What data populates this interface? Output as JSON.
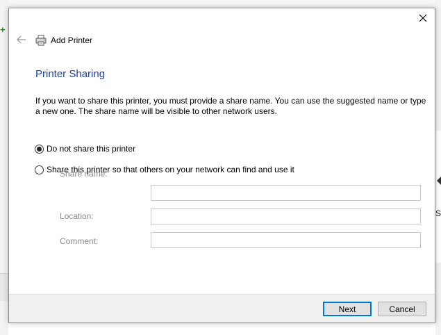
{
  "background": {
    "right_text": "S"
  },
  "dialog": {
    "header_title": "Add Printer",
    "page_title": "Printer Sharing",
    "description": "If you want to share this printer, you must provide a share name. You can use the suggested name or type a new one. The share name will be visible to other network users.",
    "options": [
      {
        "label": "Do not share this printer",
        "selected": true
      },
      {
        "label": "Share this printer so that others on your network can find and use it",
        "selected": false
      }
    ],
    "fields": {
      "share_name": {
        "label": "Share name:",
        "value": ""
      },
      "location": {
        "label": "Location:",
        "value": ""
      },
      "comment": {
        "label": "Comment:",
        "value": ""
      }
    },
    "buttons": {
      "next": "Next",
      "cancel": "Cancel"
    }
  },
  "icons": {
    "close": "close-icon",
    "back": "back-arrow-icon",
    "printer": "printer-icon"
  },
  "colors": {
    "title_blue": "#1c3ea8",
    "primary_border": "#0078d7",
    "footer_bg": "#f0f0f0"
  }
}
